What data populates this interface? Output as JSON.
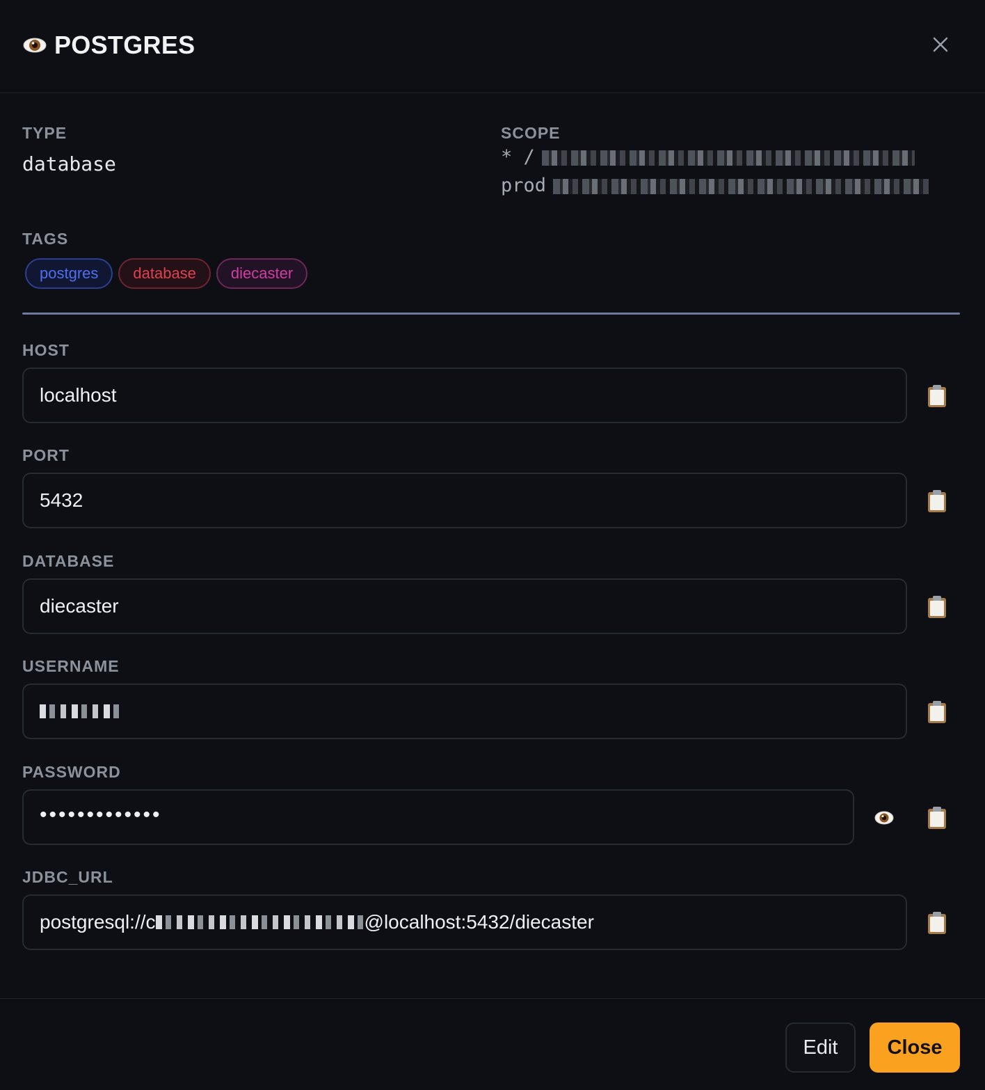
{
  "header": {
    "title": "POSTGRES",
    "title_icon": "eye-icon",
    "close_icon": "close-icon"
  },
  "meta": {
    "type_label": "TYPE",
    "type_value": "database",
    "scope_label": "SCOPE",
    "scope_line1_prefix": "* /",
    "scope_line2_prefix": "prod",
    "tags_label": "TAGS",
    "tags": [
      {
        "label": "postgres",
        "color": "#4f6ff0"
      },
      {
        "label": "database",
        "color": "#e0404f"
      },
      {
        "label": "diecaster",
        "color": "#d23ea0"
      }
    ]
  },
  "fields": {
    "host": {
      "label": "HOST",
      "value": "localhost"
    },
    "port": {
      "label": "PORT",
      "value": "5432"
    },
    "database": {
      "label": "DATABASE",
      "value": "diecaster"
    },
    "username": {
      "label": "USERNAME",
      "value": ""
    },
    "password": {
      "label": "PASSWORD",
      "value": "•••••••••••••"
    },
    "jdbc_url": {
      "label": "JDBC_URL",
      "value_prefix": "postgresql://c",
      "value_suffix": "@localhost:5432/diecaster"
    }
  },
  "footer": {
    "edit_label": "Edit",
    "close_label": "Close"
  },
  "colors": {
    "accent": "#fba120",
    "background": "#0d0f14",
    "divider": "#7e8eb4"
  }
}
